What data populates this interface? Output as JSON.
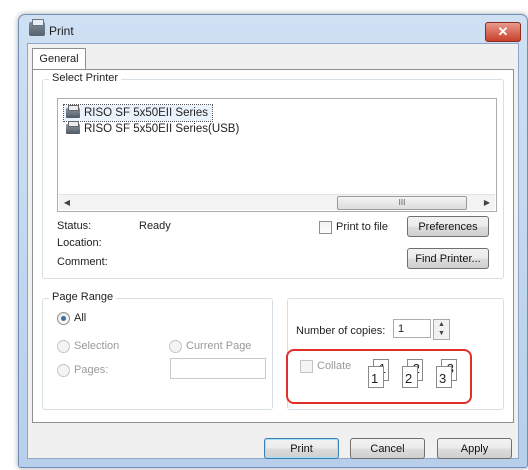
{
  "window": {
    "title": "Print",
    "close_glyph": "✕"
  },
  "tabs": [
    {
      "label": "General"
    }
  ],
  "select_printer": {
    "legend": "Select Printer",
    "printers": [
      "RISO SF 5x50EII Series",
      "RISO SF 5x50EII Series(USB)"
    ],
    "selected_index": 0,
    "scroll_left": "◀",
    "scroll_right": "▶",
    "scroll_thumb": "III"
  },
  "status": {
    "status_label": "Status:",
    "status_value": "Ready",
    "location_label": "Location:",
    "comment_label": "Comment:"
  },
  "print_to_file": {
    "label": "Print to file",
    "checked": false
  },
  "buttons": {
    "preferences": "Preferences",
    "find_printer": "Find Printer...",
    "print": "Print",
    "cancel": "Cancel",
    "apply": "Apply"
  },
  "page_range": {
    "legend": "Page Range",
    "all": "All",
    "selection": "Selection",
    "current_page": "Current Page",
    "pages": "Pages:",
    "pages_value": ""
  },
  "copies": {
    "label": "Number of copies:",
    "value": "1",
    "spin_up": "▲",
    "spin_down": "▼"
  },
  "collate": {
    "label": "Collate",
    "checked": false,
    "stacks": [
      {
        "back": "1",
        "front": "1"
      },
      {
        "back": "2",
        "front": "2"
      },
      {
        "back": "3",
        "front": "3"
      }
    ]
  },
  "colors": {
    "highlight": "#e0302a",
    "title_bar": "#b7cfea",
    "close_button": "#c7402b"
  }
}
